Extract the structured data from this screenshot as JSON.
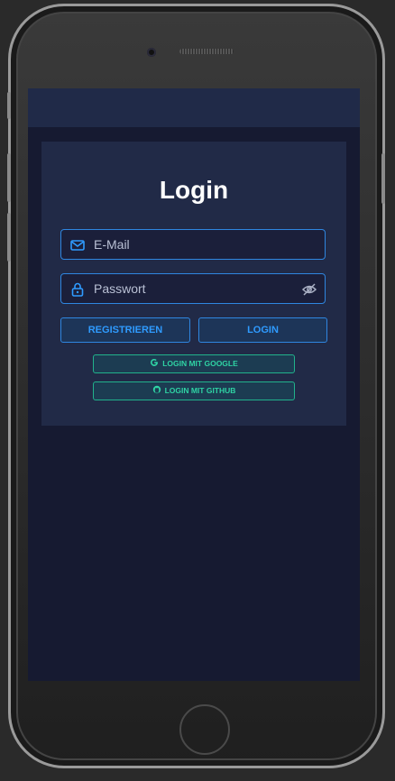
{
  "login": {
    "title": "Login",
    "email_placeholder": "E-Mail",
    "password_placeholder": "Passwort",
    "register_label": "REGISTRIEREN",
    "login_label": "LOGIN",
    "google_label": "LOGIN MIT GOOGLE",
    "github_label": "LOGIN MIT GITHUB"
  },
  "colors": {
    "screen_bg": "#161a31",
    "card_bg": "#212a47",
    "accent_blue": "#2f86e0",
    "accent_green": "#21b28c"
  },
  "icons": {
    "email": "mail-icon",
    "password": "lock-icon",
    "visibility": "eye-off-icon",
    "google": "google-icon",
    "github": "github-icon"
  }
}
